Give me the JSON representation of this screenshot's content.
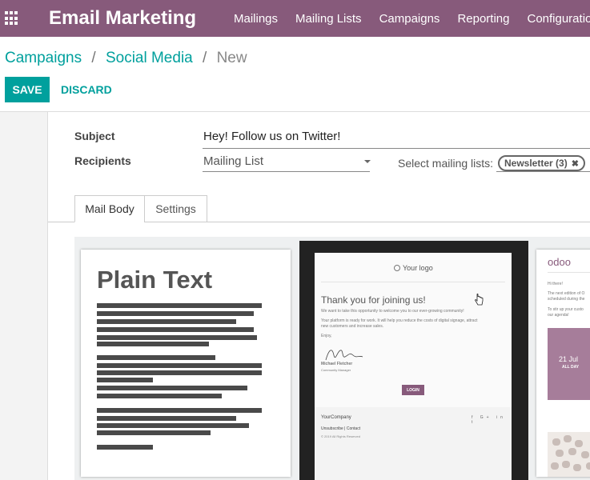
{
  "navbar": {
    "app_title": "Email Marketing",
    "menu": [
      "Mailings",
      "Mailing Lists",
      "Campaigns",
      "Reporting",
      "Configuration"
    ]
  },
  "breadcrumb": {
    "items": [
      "Campaigns",
      "Social Media"
    ],
    "current": "New",
    "separator": "/"
  },
  "actions": {
    "save_label": "SAVE",
    "discard_label": "DISCARD"
  },
  "form": {
    "subject_label": "Subject",
    "subject_value": "Hey! Follow us on Twitter!",
    "recipients_label": "Recipients",
    "recipients_value": "Mailing List",
    "mailing_lists_label": "Select mailing lists:",
    "mailing_list_tag": "Newsletter (3)"
  },
  "tabs": [
    "Mail Body",
    "Settings"
  ],
  "templates": {
    "plain": {
      "title": "Plain Text"
    },
    "welcome": {
      "logo_text": "Your logo",
      "heading": "Thank you for joining us!",
      "line1": "We want to take this opportunity to welcome you to our ever-growing community!",
      "line2": "Your platform is ready for work. It will help you reduce the costs of digital signage, attract",
      "line3": "new customers and increase sales.",
      "line4": "Enjoy,",
      "signer_name": "Michael Fletcher",
      "signer_role": "Community Manager",
      "button": "LOGIN",
      "company": "YourCompany",
      "social": "f G+ in t",
      "unsubscribe": "Unsubscribe | Contact",
      "rights": "© 2019 All Rights Reserved"
    },
    "event": {
      "logo": "odoo",
      "greeting": "Hi there!",
      "line1": "The next edition of O",
      "line2": "scheduled during the",
      "line3": "To stir up your custo",
      "line4": "our agenda!",
      "date": "21 Jul",
      "date_sub": "ALL DAY"
    }
  },
  "colors": {
    "brand": "#875a7b",
    "accent": "#00a09d"
  }
}
